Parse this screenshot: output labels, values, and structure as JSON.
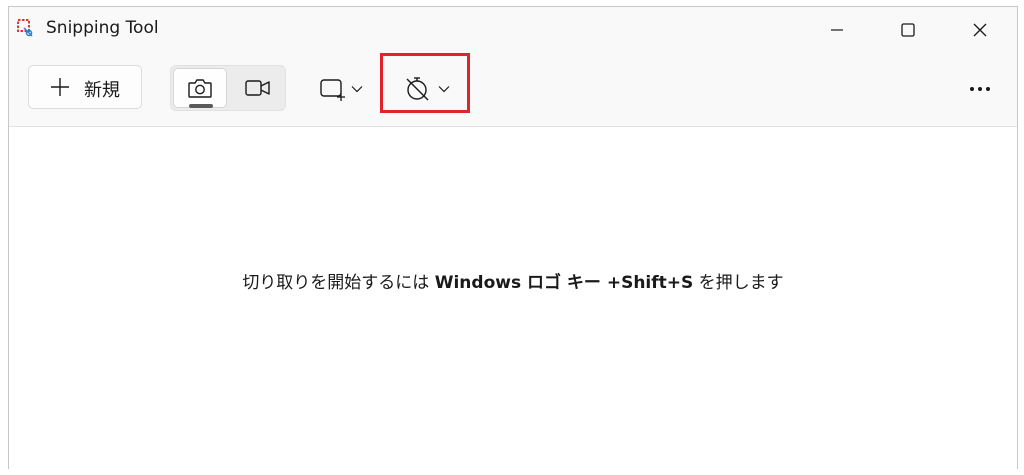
{
  "window": {
    "title": "Snipping Tool",
    "controls": {
      "minimize": "minimize",
      "maximize": "maximize",
      "close": "close"
    }
  },
  "toolbar": {
    "new_label": "新規",
    "modes": [
      {
        "name": "snip-mode",
        "icon": "camera-icon",
        "selected": true
      },
      {
        "name": "record-mode",
        "icon": "video-camera-icon",
        "selected": false
      }
    ],
    "snip_shape_icon": "rectangle-snip-icon",
    "timer_icon": "no-timer-icon",
    "more_icon": "more-icon"
  },
  "content": {
    "hint_prefix": "切り取りを開始するには",
    "hint_keys": "Windows ロゴ キー +Shift+S",
    "hint_suffix": "を押します"
  },
  "colors": {
    "highlight_border": "#e0242b",
    "background": "#f9f9f9",
    "content_background": "#ffffff"
  }
}
